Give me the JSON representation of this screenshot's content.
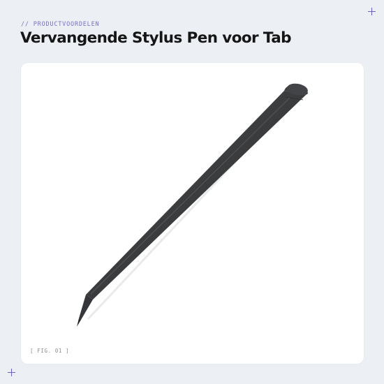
{
  "header": {
    "eyebrow": "// PRODUCTVOORDELEN",
    "title": "Vervangende Stylus Pen voor Tab"
  },
  "figure": {
    "label": "[ FIG. 01 ]",
    "image_subject": "stylus-pen"
  },
  "colors": {
    "background": "#eceff4",
    "accent": "#6c63c8",
    "card": "#ffffff",
    "pen": "#3b3d3f"
  }
}
